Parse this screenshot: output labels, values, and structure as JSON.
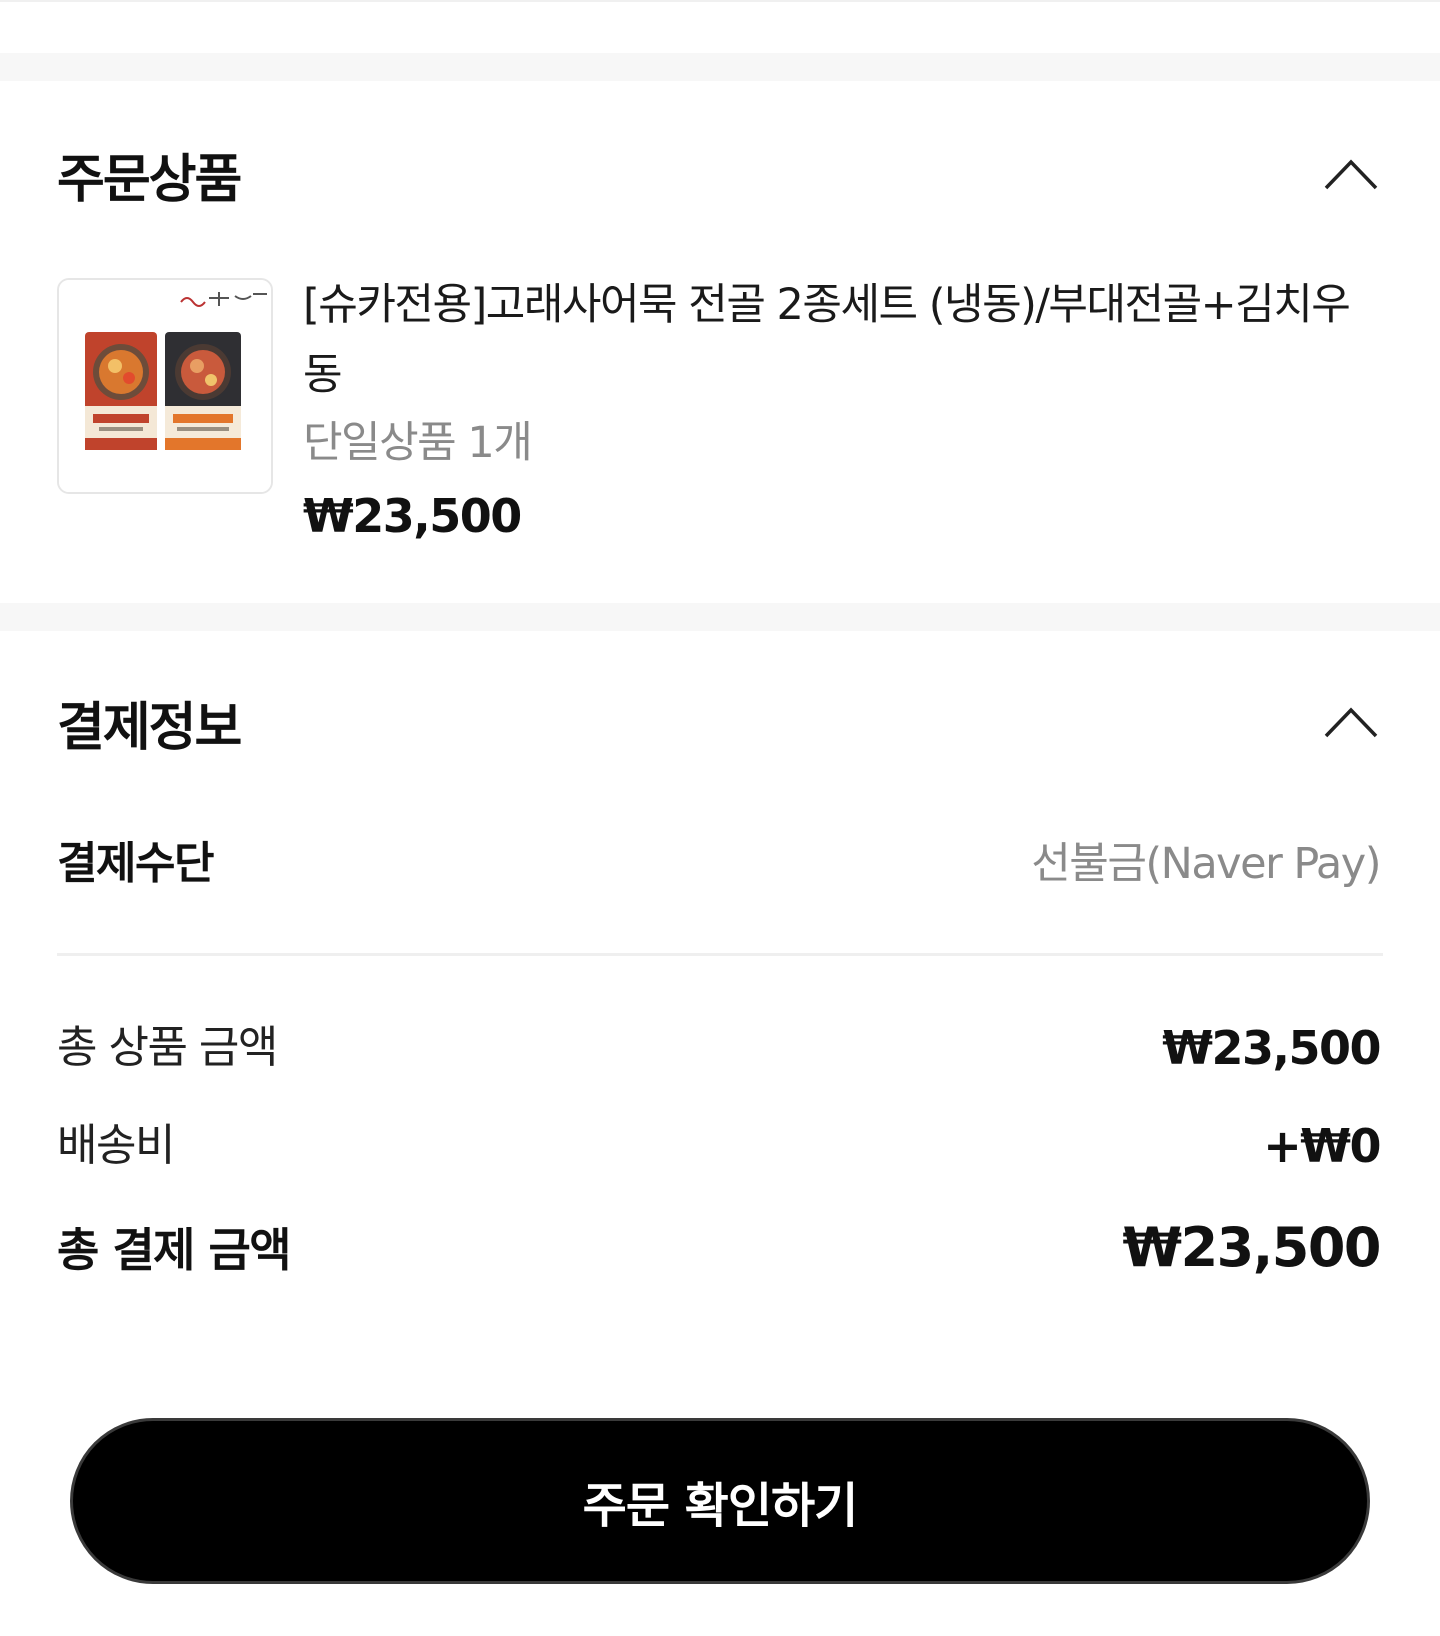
{
  "order_section": {
    "title": "주문상품",
    "item": {
      "thumbnail_icon": "product-image-icon",
      "name": "[슈카전용]고래사어묵 전골 2종세트 (냉동)/부대전골+김치우동",
      "option": "단일상품 1개",
      "price": "₩23,500"
    }
  },
  "payment_section": {
    "title": "결제정보",
    "method_label": "결제수단",
    "method_value": "선불금(Naver Pay)",
    "subtotal_label": "총 상품 금액",
    "subtotal_value": "₩23,500",
    "shipping_label": "배송비",
    "shipping_value": "+₩0",
    "total_label": "총 결제 금액",
    "total_value": "₩23,500"
  },
  "confirm_button": {
    "label": "주문 확인하기"
  },
  "colors": {
    "accent": "#000000",
    "muted_text": "#8a8a8a",
    "section_gap": "#f7f7f7"
  }
}
